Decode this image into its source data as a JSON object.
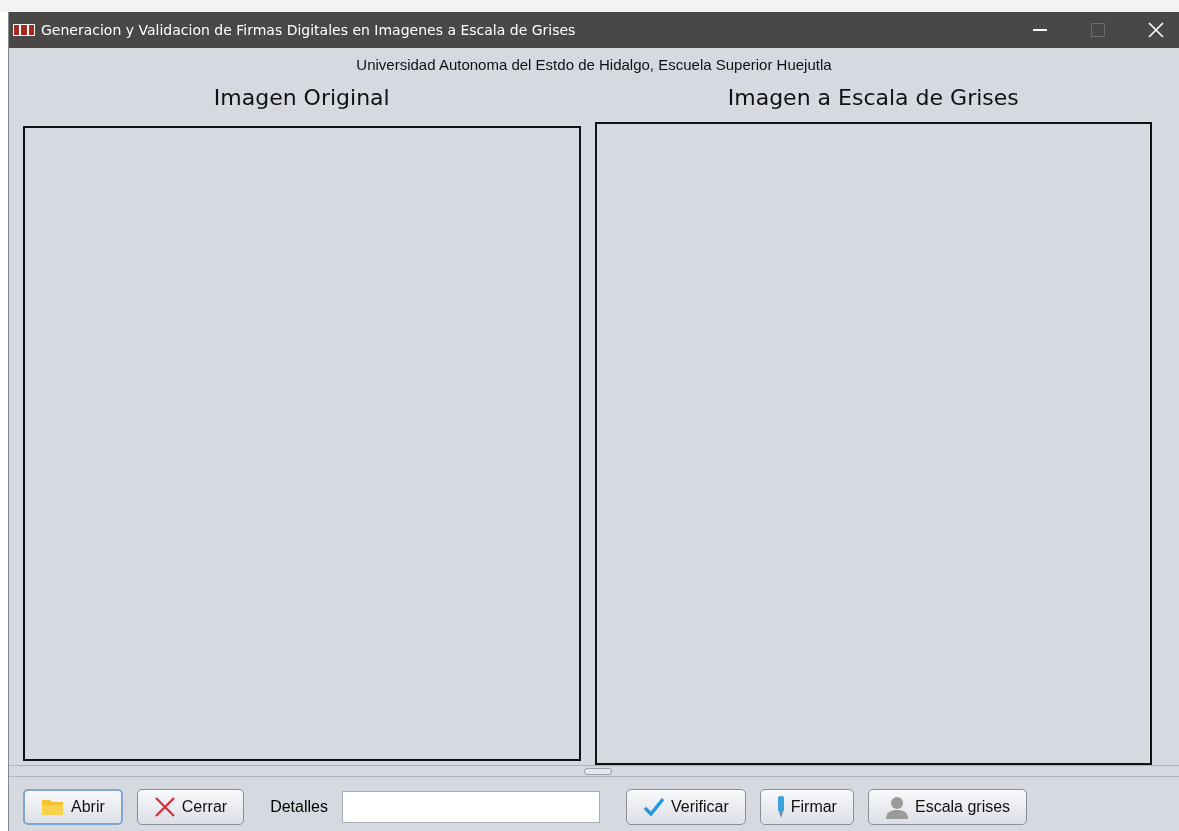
{
  "window": {
    "title": "Generacion y Validacion de Firmas Digitales en Imagenes a Escala de Grises"
  },
  "subtitle": "Universidad Autonoma del Estdo de Hidalgo, Escuela Superior Huejutla",
  "panels": [
    {
      "heading": "Imagen Original"
    },
    {
      "heading": "Imagen a Escala de Grises"
    }
  ],
  "toolbar": {
    "buttons_left": [
      {
        "kind": "folder",
        "label": "Abrir",
        "focused": true
      },
      {
        "kind": "cross",
        "label": "Cerrar",
        "focused": false
      }
    ],
    "details_label": "Detalles",
    "buttons_right": [
      {
        "kind": "check",
        "label": "Verificar",
        "focused": false
      },
      {
        "kind": "pen",
        "label": "Firmar",
        "focused": false
      },
      {
        "kind": "person",
        "label": "Escala grises",
        "focused": false
      }
    ]
  }
}
